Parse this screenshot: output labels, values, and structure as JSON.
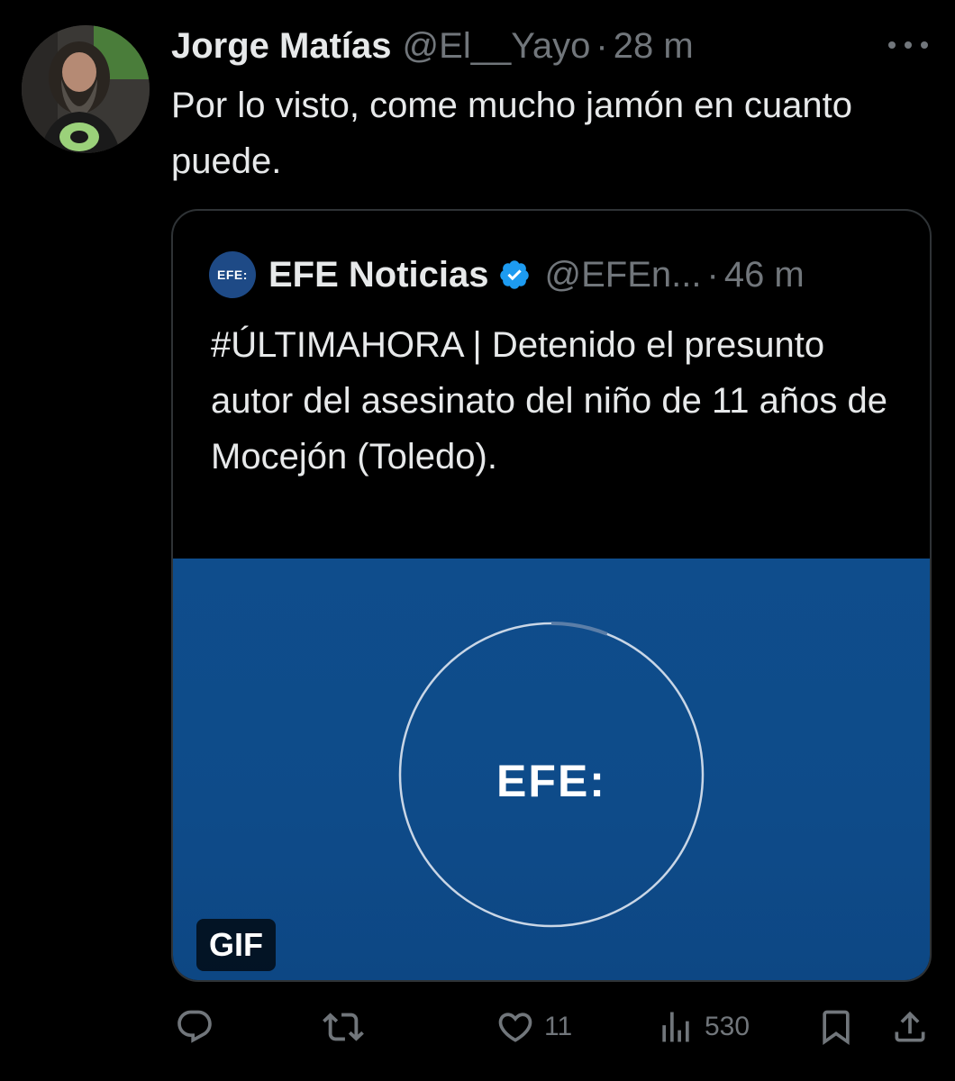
{
  "tweet": {
    "author_name": "Jorge Matías",
    "author_handle": "@El__Yayo",
    "separator": "·",
    "time": "28 m",
    "text": "Por lo visto, come mucho jamón en cuanto puede."
  },
  "quote": {
    "avatar_label": "EFE:",
    "author_name": "EFE Noticias",
    "author_handle": "@EFEn...",
    "separator": "·",
    "time": "46 m",
    "text": "#ÚLTIMAHORA | Detenido el presunto autor del asesinato del niño de 11 años de Mocejón (Toledo).",
    "media": {
      "logo_text": "EFE:",
      "badge": "GIF",
      "progress_arc": 0.06
    }
  },
  "actions": {
    "reply_count": "",
    "retweet_count": "",
    "like_count": "11",
    "views_count": "530"
  },
  "icons": {
    "verified": "verified-badge-icon",
    "more": "more-icon",
    "reply": "reply-icon",
    "retweet": "retweet-icon",
    "like": "heart-icon",
    "views": "views-icon",
    "bookmark": "bookmark-icon",
    "share": "share-icon"
  },
  "colors": {
    "background": "#000000",
    "text": "#e7e9ea",
    "muted": "#71767b",
    "verified": "#1d9bf0",
    "media_blue": "#0f4d8c"
  }
}
